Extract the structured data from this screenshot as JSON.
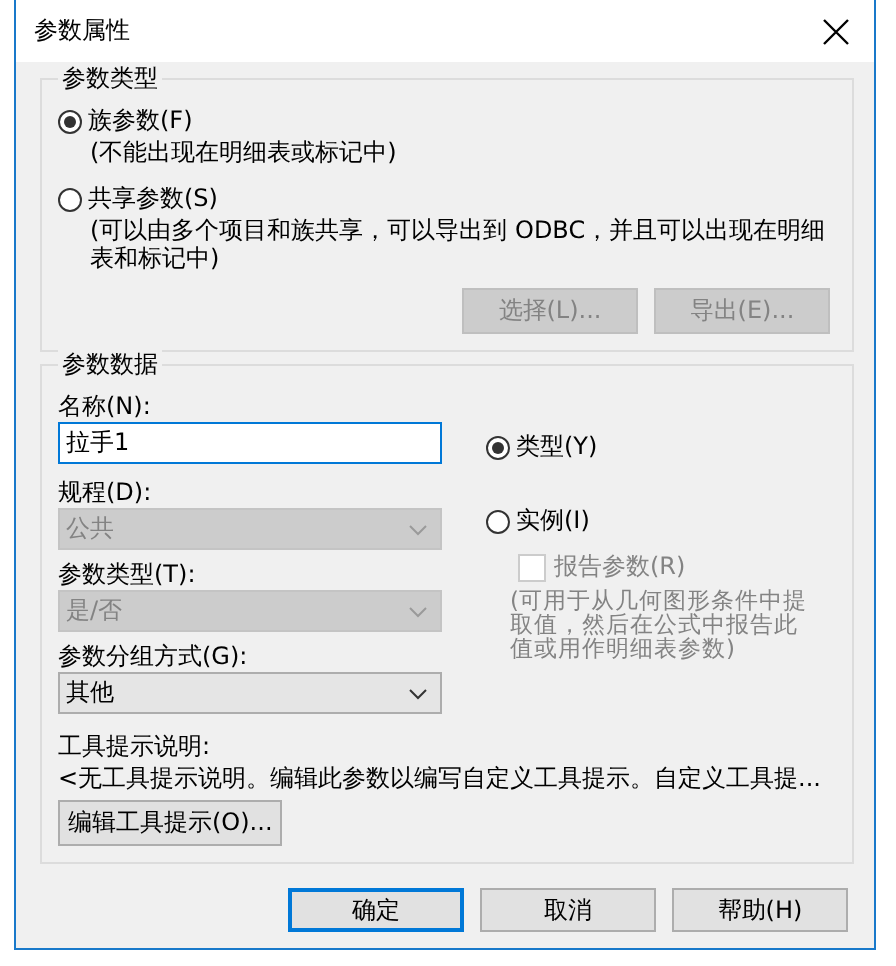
{
  "window": {
    "title": "参数属性"
  },
  "parameter_type": {
    "title": "参数类型",
    "options": [
      {
        "label": "族参数(F)",
        "note": "(不能出现在明细表或标记中)",
        "selected": true
      },
      {
        "label": "共享参数(S)",
        "note": "(可以由多个项目和族共享，可以导出到 ODBC，并且可以出现在明细表和标记中)",
        "selected": false
      }
    ],
    "buttons": [
      {
        "label": "选择(L)...",
        "disabled": true
      },
      {
        "label": "导出(E)...",
        "disabled": true
      }
    ]
  },
  "parameter_data": {
    "title": "参数数据",
    "name_label": "名称(N):",
    "name_value": "拉手1",
    "fields": [
      {
        "label": "规程(D):",
        "value": "公共",
        "disabled": true
      },
      {
        "label": "参数类型(T):",
        "value": "是/否",
        "disabled": true
      },
      {
        "label": "参数分组方式(G):",
        "value": "其他",
        "disabled": false
      }
    ],
    "scope": [
      {
        "label": "类型(Y)",
        "selected": true
      },
      {
        "label": "实例(I)",
        "selected": false
      }
    ],
    "report": {
      "label": "报告参数(R)",
      "checked": false,
      "disabled": true
    },
    "report_note": "(可用于从几何图形条件中提取值，然后在公式中报告此值或用作明细表参数)",
    "tooltip_label": "工具提示说明:",
    "tooltip_text": "<无工具提示说明。编辑此参数以编写自定义工具提示。自定义工具提...",
    "edit_button": "编辑工具提示(O)..."
  },
  "buttons": [
    {
      "label": "确定",
      "default": true
    },
    {
      "label": "取消",
      "default": false
    },
    {
      "label": "帮助(H)",
      "default": false
    }
  ]
}
